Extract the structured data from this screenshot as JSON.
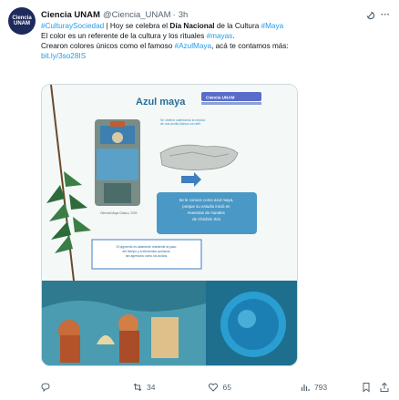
{
  "author": {
    "name": "Ciencia UNAM",
    "handle": "@Ciencia_UNAM",
    "time": "3h",
    "avatar_text": [
      "Ciencia",
      "UNAM"
    ]
  },
  "tweet": {
    "line1_tag": "#CulturaySociedad",
    "line1_text_a": " | Hoy se celebra el ",
    "line1_bold": "Día Nacional",
    "line1_text_b": " de la Cultura ",
    "line1_tag2": "#Maya",
    "line2_text": "El color es un referente de la cultura y los rituales ",
    "line2_tag": "#mayas",
    "line2_end": ".",
    "line3_text_a": "Crearon colores únicos como el famoso ",
    "line3_tag": "#AzulMaya",
    "line3_text_b": ", acá te contamos más:",
    "link": "bit.ly/3so28IS"
  },
  "infographic": {
    "title": "Azul maya",
    "badge": "Ciencia UNAM",
    "note1": "Se obtiene calentando la mezcla de una arcilla blanca con añil.",
    "note2": "Se le conoce como azul maya, porque su estudio inició en muestras de murales de Chichén Itzá.",
    "note3": "El pigmento es altamente resistente al paso del tiempo y a elementos químicos tan agresivos como los ácidos.",
    "caption": "Ofrenda Maya Clásico, 2009"
  },
  "actions": {
    "reply_count": "",
    "retweet_count": "34",
    "like_count": "65",
    "views_count": "793"
  },
  "colors": {
    "link": "#1d9bf0",
    "muted": "#536471",
    "accent_blue": "#3e8fc1",
    "panel_blue": "#4a98c5"
  }
}
